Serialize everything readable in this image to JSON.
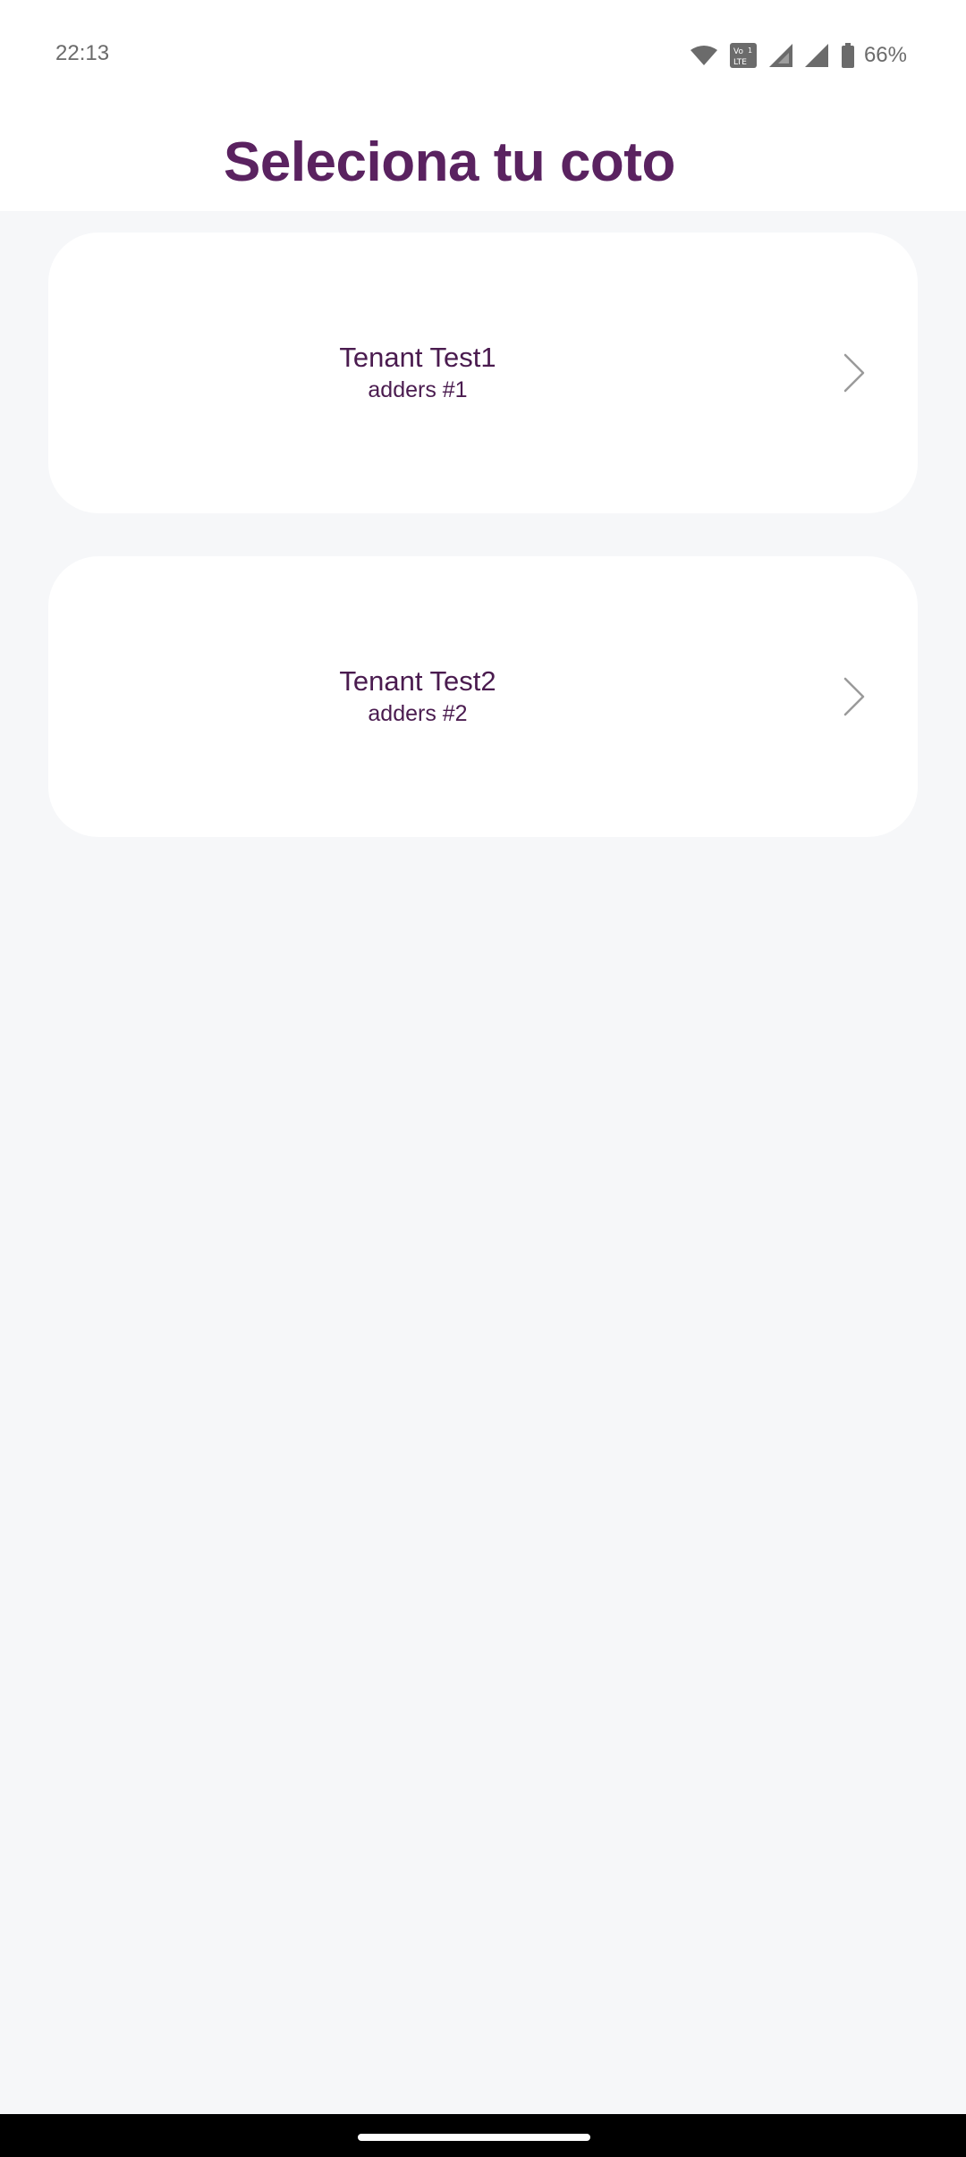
{
  "status_bar": {
    "time": "22:13",
    "battery": "66%",
    "icons": [
      "wifi-icon",
      "volte-icon",
      "signal-icon",
      "signal-icon",
      "battery-icon"
    ]
  },
  "header": {
    "title": "Seleciona tu coto"
  },
  "tenants": [
    {
      "name": "Tenant Test1",
      "address": "adders #1",
      "icon": "chevron-right-icon"
    },
    {
      "name": "Tenant Test2",
      "address": "adders #2",
      "icon": "chevron-right-icon"
    }
  ],
  "colors": {
    "title": "#5a2260",
    "card_text": "#4a1b4f",
    "background": "#f6f7f9",
    "card": "#ffffff"
  }
}
